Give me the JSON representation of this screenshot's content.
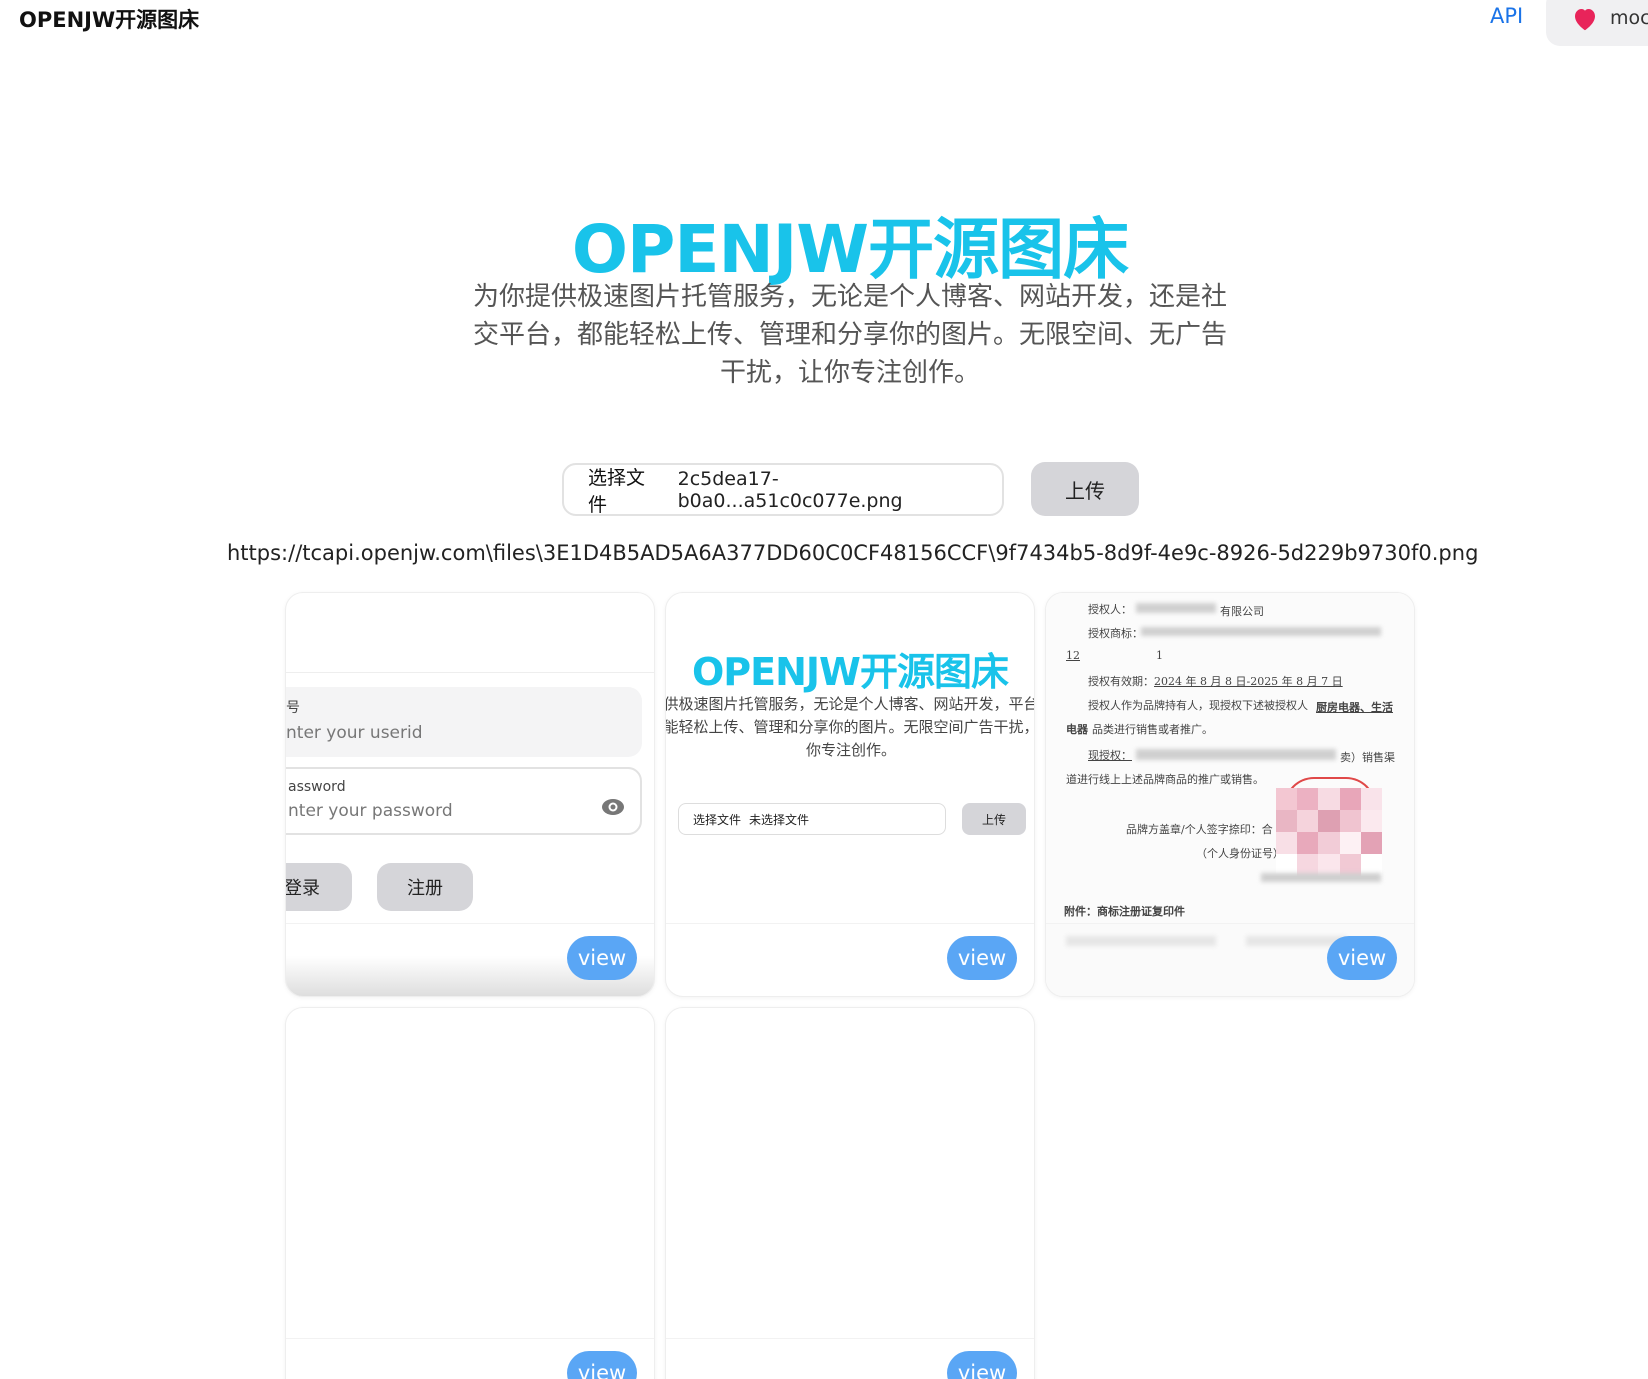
{
  "header": {
    "brand": "OPENJW开源图床",
    "api_link": "API",
    "user_name": "moc"
  },
  "hero": {
    "title": "OPENJW开源图床",
    "subtitle": "为你提供极速图片托管服务，无论是个人博客、网站开发，还是社交平台，都能轻松上传、管理和分享你的图片。无限空间、无广告干扰，让你专注创作。"
  },
  "upload": {
    "file_button": "选择文件",
    "file_name": "2c5dea17-b0a0...a51c0c077e.png",
    "upload_button": "上传",
    "result_url": "https://tcapi.openjw.com\\files\\3E1D4B5AD5A6A377DD60C0CF48156CCF\\9f7434b5-8d9f-4e9c-8926-5d229b9730f0.png"
  },
  "gallery": {
    "view_label": "view",
    "card1": {
      "field1_label": "号",
      "field1_placeholder": "nter your userid",
      "field2_label": "assword",
      "field2_placeholder": "nter your password",
      "login_button": "登录",
      "register_button": "注册"
    },
    "card2": {
      "title": "OPENJW开源图床",
      "subtitle": "提供极速图片托管服务，无论是个人博客、网站开发，平台，都能轻松上传、管理和分享你的图片。无限空间广告干扰，让你专注创作。",
      "file_button": "选择文件",
      "file_status": "未选择文件",
      "upload_button": "上传"
    },
    "card3": {
      "lines": [
        "授权人：",
        "有限公司",
        "授权商标：",
        "12",
        "1",
        "授权有效期：",
        "2024 年 8 月 8 日-2025 年 8 月 7 日",
        "授权人作为品牌持有人，现授权下述被授权人",
        "厨房电器、生活",
        "电器",
        "品类进行销售或者推广。",
        "现授权：",
        "卖）销售渠",
        "道进行线上上述品牌商品的推广或销售。",
        "品牌方盖章/个人签字捺印：合",
        "（个人身份证号）",
        "附件：商标注册证复印件"
      ]
    }
  },
  "colors": {
    "accent": "#19c3ea",
    "view_button": "#5aa6f5",
    "link": "#1a73e8",
    "heart": "#e8245a"
  }
}
